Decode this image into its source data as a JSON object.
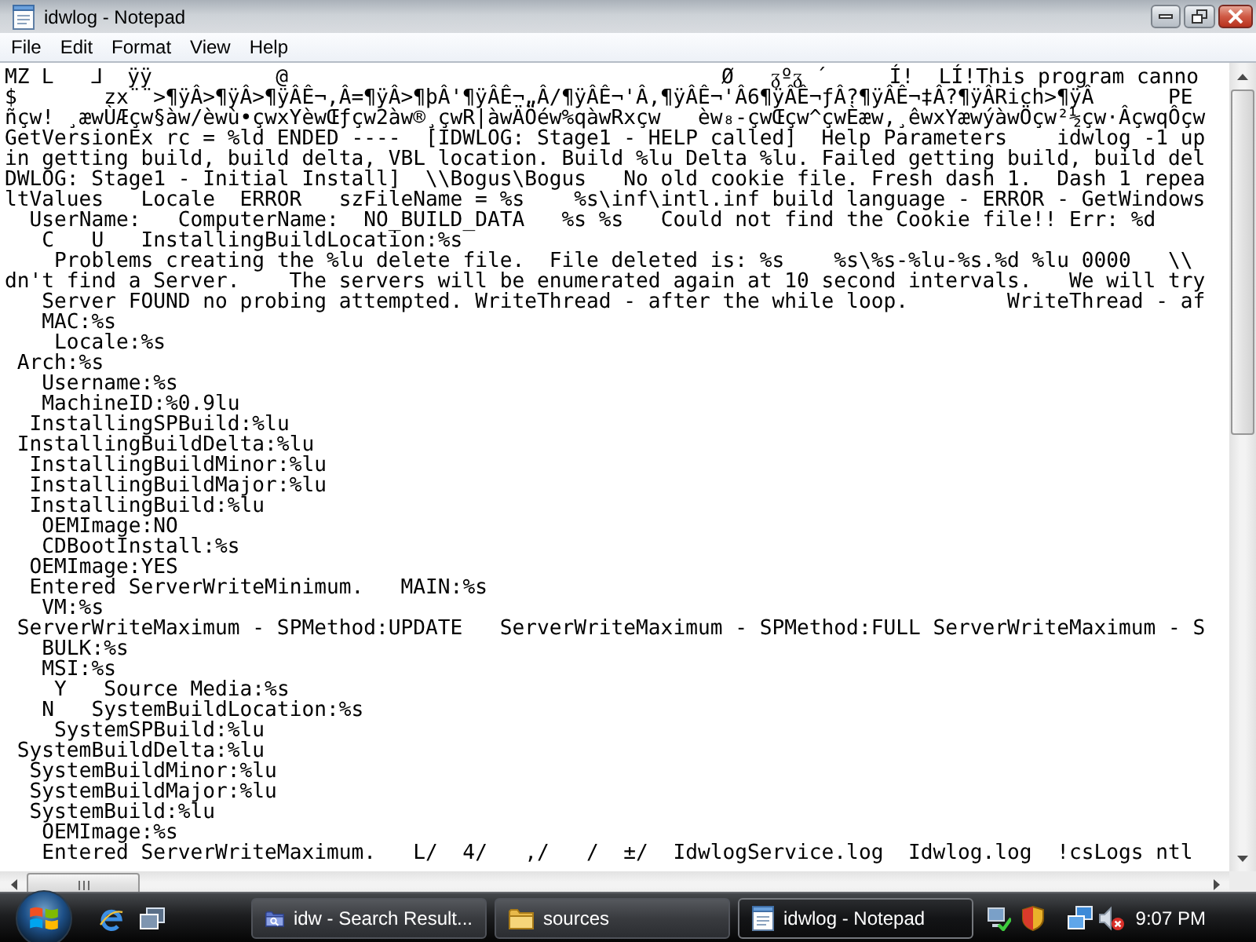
{
  "window": {
    "title": "idwlog - Notepad"
  },
  "menu_bar": [
    "File",
    "Edit",
    "Format",
    "View",
    "Help"
  ],
  "document": {
    "lines": [
      "MZ ᒪ   ᒧ  ÿÿ          @                                   Ø   ᵹºᵹ ´     Í!  LÍ!This program canno",
      "$       zx¨¨>¶ÿÂ>¶ÿÂ>¶ÿÂÊ¬‚Â=¶ÿÂ>¶þÂ'¶ÿÂÊ¬„Â/¶ÿÂÊ¬'Â,¶ÿÂÊ¬'Â6¶ÿÂÊ¬ƒÂ?¶ÿÂÊ¬‡Â?¶ÿÂRich>¶ÿÂ      PE",
      "ñçw! ¸æwÙÆçw§àw/èwù•çwxYèwŒƒçw2àw®¸çwR|àwÄÖéw%qàwRxçw   èw₈-çwŒçw^çwÈæw,¸êwxYæwýàwÖçw²½çw·ÂçwqÔçw",
      "GetVersionEx rc = %ld ENDED ----  [IDWLOG: Stage1 - HELP called]  Help Parameters    idwlog -1 up",
      "in getting build, build delta, VBL location. Build %lu Delta %lu. Failed getting build, build del",
      "DWLOG: Stage1 - Initial Install]  \\\\Bogus\\Bogus   No old cookie file. Fresh dash 1.  Dash 1 repea",
      "ltValues   Locale  ERROR   szFileName = %s    %s\\inf\\intl.inf build language - ERROR - GetWindows",
      "  UserName:   ComputerName:  NO_BUILD_DATA   %s %s   Could not find the Cookie file!! Err: %d",
      "   C   U   InstallingBuildLocation:%s",
      "    Problems creating the %lu delete file.  File deleted is: %s    %s\\%s-%lu-%s.%d %lu 0000   \\\\",
      "dn't find a Server.    The servers will be enumerated again at 10 second intervals.   We will try",
      "   Server FOUND no probing attempted. WriteThread - after the while loop.        WriteThread - af",
      "   MAC:%s",
      "    Locale:%s",
      " Arch:%s",
      "   Username:%s",
      "   MachineID:%0.9lu",
      "  InstallingSPBuild:%lu",
      " InstallingBuildDelta:%lu",
      "  InstallingBuildMinor:%lu",
      "  InstallingBuildMajor:%lu",
      "  InstallingBuild:%lu",
      "   OEMImage:NO",
      "   CDBootInstall:%s",
      "  OEMImage:YES",
      "  Entered ServerWriteMinimum.   MAIN:%s",
      "   VM:%s",
      " ServerWriteMaximum - SPMethod:UPDATE   ServerWriteMaximum - SPMethod:FULL ServerWriteMaximum - S",
      "   BULK:%s",
      "   MSI:%s",
      "    Y   Source Media:%s",
      "   N   SystemBuildLocation:%s",
      "    SystemSPBuild:%lu",
      " SystemBuildDelta:%lu",
      "  SystemBuildMinor:%lu",
      "  SystemBuildMajor:%lu",
      "  SystemBuild:%lu",
      "   OEMImage:%s",
      "   Entered ServerWriteMaximum.   L/  4/   ,/   /  ±/  IdwlogService.log  Idwlog.log  !csLogs ntl"
    ]
  },
  "taskbar": {
    "buttons": [
      {
        "label": "idw - Search Result...",
        "kind": "search",
        "selected": false
      },
      {
        "label": "sources",
        "kind": "folder",
        "selected": false
      },
      {
        "label": "idwlog - Notepad",
        "kind": "notepad",
        "selected": true
      }
    ],
    "clock": "9:07 PM"
  }
}
